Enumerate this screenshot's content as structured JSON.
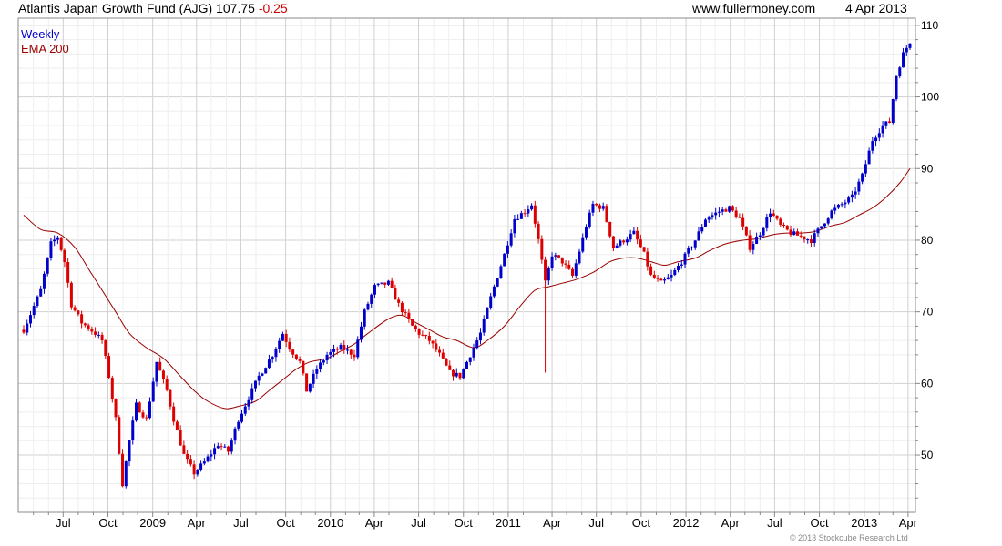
{
  "header": {
    "title": "Atlantis Japan Growth Fund (AJG)",
    "last": "107.75",
    "change": "-0.25",
    "site": "www.fullermoney.com",
    "date": "4 Apr 2013"
  },
  "footer": {
    "copyright": "© 2013 Stockcube Research Ltd"
  },
  "colors": {
    "up": "#0000cc",
    "down": "#dd0000",
    "ema": "#990000",
    "grid": "#dddddd",
    "axis": "#888888"
  },
  "chart_data": {
    "type": "ohlc",
    "x_axis_type": "date",
    "x_range": [
      "2008-04-11",
      "2013-04-05"
    ],
    "grid": true,
    "y_range": [
      42,
      111
    ],
    "y_ticks": [
      50,
      60,
      70,
      80,
      90,
      100,
      110
    ],
    "x_ticks": [
      {
        "label": "Jul",
        "date": "2008-07-01"
      },
      {
        "label": "Oct",
        "date": "2008-10-01"
      },
      {
        "label": "2009",
        "date": "2009-01-01"
      },
      {
        "label": "Apr",
        "date": "2009-04-01"
      },
      {
        "label": "Jul",
        "date": "2009-07-01"
      },
      {
        "label": "Oct",
        "date": "2009-10-01"
      },
      {
        "label": "2010",
        "date": "2010-01-01"
      },
      {
        "label": "Apr",
        "date": "2010-04-01"
      },
      {
        "label": "Jul",
        "date": "2010-07-01"
      },
      {
        "label": "Oct",
        "date": "2010-10-01"
      },
      {
        "label": "2011",
        "date": "2011-01-01"
      },
      {
        "label": "Apr",
        "date": "2011-04-01"
      },
      {
        "label": "Jul",
        "date": "2011-07-01"
      },
      {
        "label": "Oct",
        "date": "2011-10-01"
      },
      {
        "label": "2012",
        "date": "2012-01-01"
      },
      {
        "label": "Apr",
        "date": "2012-04-01"
      },
      {
        "label": "Jul",
        "date": "2012-07-01"
      },
      {
        "label": "Oct",
        "date": "2012-10-01"
      },
      {
        "label": "2013",
        "date": "2013-01-01"
      },
      {
        "label": "Apr",
        "date": "2013-04-01"
      }
    ],
    "legend": {
      "position": "top-left",
      "items": [
        {
          "label": "Weekly",
          "color": "#0000cc"
        },
        {
          "label": "EMA 200",
          "color": "#990000"
        }
      ]
    },
    "series": [
      {
        "name": "Weekly",
        "kind": "price",
        "values": [
          [
            "2008-04-11",
            67.5
          ],
          [
            "2008-05-16",
            73
          ],
          [
            "2008-06-06",
            79.5
          ],
          [
            "2008-06-20",
            80.5
          ],
          [
            "2008-07-04",
            77
          ],
          [
            "2008-07-18",
            71
          ],
          [
            "2008-08-08",
            68.5
          ],
          [
            "2008-09-05",
            67
          ],
          [
            "2008-09-19",
            66
          ],
          [
            "2008-10-03",
            61
          ],
          [
            "2008-10-17",
            55
          ],
          [
            "2008-10-31",
            46
          ],
          [
            "2008-11-14",
            52
          ],
          [
            "2008-11-28",
            57
          ],
          [
            "2008-12-19",
            55
          ],
          [
            "2009-01-09",
            63
          ],
          [
            "2009-01-30",
            59
          ],
          [
            "2009-02-13",
            55
          ],
          [
            "2009-03-06",
            50
          ],
          [
            "2009-03-27",
            47.5
          ],
          [
            "2009-04-17",
            49
          ],
          [
            "2009-05-15",
            51.5
          ],
          [
            "2009-06-05",
            50.5
          ],
          [
            "2009-06-26",
            55
          ],
          [
            "2009-07-17",
            58
          ],
          [
            "2009-08-07",
            61
          ],
          [
            "2009-09-04",
            64
          ],
          [
            "2009-09-25",
            67
          ],
          [
            "2009-10-09",
            65
          ],
          [
            "2009-10-30",
            63
          ],
          [
            "2009-11-13",
            59
          ],
          [
            "2009-12-04",
            62
          ],
          [
            "2009-12-25",
            64
          ],
          [
            "2010-01-22",
            65
          ],
          [
            "2010-02-19",
            64
          ],
          [
            "2010-03-12",
            70
          ],
          [
            "2010-04-02",
            73.5
          ],
          [
            "2010-04-30",
            74
          ],
          [
            "2010-05-21",
            71
          ],
          [
            "2010-06-18",
            68
          ],
          [
            "2010-07-02",
            67
          ],
          [
            "2010-07-23",
            66
          ],
          [
            "2010-08-13",
            64
          ],
          [
            "2010-09-03",
            61.5
          ],
          [
            "2010-09-24",
            61
          ],
          [
            "2010-10-08",
            63
          ],
          [
            "2010-11-05",
            67
          ],
          [
            "2010-11-26",
            72
          ],
          [
            "2010-12-24",
            78
          ],
          [
            "2011-01-14",
            83
          ],
          [
            "2011-02-04",
            84
          ],
          [
            "2011-02-18",
            85
          ],
          [
            "2011-03-04",
            80
          ],
          [
            "2011-03-18",
            74
          ],
          [
            "2011-04-01",
            78
          ],
          [
            "2011-04-22",
            77
          ],
          [
            "2011-05-13",
            75
          ],
          [
            "2011-06-10",
            82
          ],
          [
            "2011-06-24",
            85
          ],
          [
            "2011-07-15",
            84.5
          ],
          [
            "2011-08-05",
            79
          ],
          [
            "2011-08-26",
            80
          ],
          [
            "2011-09-16",
            81
          ],
          [
            "2011-10-07",
            78
          ],
          [
            "2011-10-21",
            75
          ],
          [
            "2011-11-11",
            74
          ],
          [
            "2011-12-02",
            75
          ],
          [
            "2011-12-23",
            77
          ],
          [
            "2012-01-20",
            80
          ],
          [
            "2012-02-10",
            83
          ],
          [
            "2012-03-09",
            84
          ],
          [
            "2012-03-30",
            84.5
          ],
          [
            "2012-04-20",
            83
          ],
          [
            "2012-05-11",
            79
          ],
          [
            "2012-06-01",
            81
          ],
          [
            "2012-06-22",
            84
          ],
          [
            "2012-07-13",
            82
          ],
          [
            "2012-08-03",
            81
          ],
          [
            "2012-08-24",
            80.5
          ],
          [
            "2012-09-14",
            80
          ],
          [
            "2012-10-05",
            82
          ],
          [
            "2012-10-26",
            84
          ],
          [
            "2012-11-16",
            85
          ],
          [
            "2012-12-07",
            86
          ],
          [
            "2012-12-28",
            89
          ],
          [
            "2013-01-18",
            94
          ],
          [
            "2013-02-08",
            96
          ],
          [
            "2013-02-22",
            96.5
          ],
          [
            "2013-03-08",
            103
          ],
          [
            "2013-03-22",
            106
          ],
          [
            "2013-04-05",
            107.75
          ]
        ]
      },
      {
        "name": "EMA 200",
        "kind": "ema",
        "values": [
          [
            "2008-04-11",
            83.5
          ],
          [
            "2008-05-16",
            81.5
          ],
          [
            "2008-06-20",
            81
          ],
          [
            "2008-07-25",
            79
          ],
          [
            "2008-08-22",
            76
          ],
          [
            "2008-09-19",
            73
          ],
          [
            "2008-10-17",
            70
          ],
          [
            "2008-11-14",
            67
          ],
          [
            "2008-12-19",
            65
          ],
          [
            "2009-01-23",
            63.5
          ],
          [
            "2009-02-27",
            61
          ],
          [
            "2009-03-27",
            59
          ],
          [
            "2009-04-24",
            57.5
          ],
          [
            "2009-05-29",
            56.5
          ],
          [
            "2009-06-26",
            56.8
          ],
          [
            "2009-07-31",
            57.5
          ],
          [
            "2009-08-28",
            59
          ],
          [
            "2009-09-25",
            60.5
          ],
          [
            "2009-10-23",
            62
          ],
          [
            "2009-11-20",
            63
          ],
          [
            "2009-12-25",
            63.5
          ],
          [
            "2010-01-22",
            64.5
          ],
          [
            "2010-02-19",
            65.5
          ],
          [
            "2010-03-19",
            67
          ],
          [
            "2010-04-30",
            69
          ],
          [
            "2010-05-28",
            69.5
          ],
          [
            "2010-06-25",
            68.5
          ],
          [
            "2010-07-23",
            67.5
          ],
          [
            "2010-08-20",
            66.5
          ],
          [
            "2010-09-17",
            66
          ],
          [
            "2010-10-22",
            65
          ],
          [
            "2010-11-19",
            66
          ],
          [
            "2010-12-24",
            68
          ],
          [
            "2011-01-28",
            71
          ],
          [
            "2011-02-25",
            73
          ],
          [
            "2011-03-25",
            73.5
          ],
          [
            "2011-04-22",
            74
          ],
          [
            "2011-05-20",
            74.5
          ],
          [
            "2011-06-24",
            75.5
          ],
          [
            "2011-07-29",
            77
          ],
          [
            "2011-08-26",
            77.5
          ],
          [
            "2011-09-23",
            77.5
          ],
          [
            "2011-10-21",
            77
          ],
          [
            "2011-11-18",
            76.5
          ],
          [
            "2011-12-16",
            77
          ],
          [
            "2012-01-20",
            77.5
          ],
          [
            "2012-02-17",
            78.5
          ],
          [
            "2012-03-23",
            79.5
          ],
          [
            "2012-04-27",
            80
          ],
          [
            "2012-05-25",
            80.2
          ],
          [
            "2012-06-29",
            80.8
          ],
          [
            "2012-07-27",
            81
          ],
          [
            "2012-08-24",
            81
          ],
          [
            "2012-09-21",
            81.2
          ],
          [
            "2012-10-26",
            82
          ],
          [
            "2012-11-23",
            82.5
          ],
          [
            "2012-12-21",
            83.5
          ],
          [
            "2013-01-18",
            84.5
          ],
          [
            "2013-02-15",
            86
          ],
          [
            "2013-03-15",
            88
          ],
          [
            "2013-04-05",
            90
          ]
        ]
      }
    ],
    "notable_spike_low": {
      "date": "2011-03-18",
      "value": 61.5
    }
  }
}
